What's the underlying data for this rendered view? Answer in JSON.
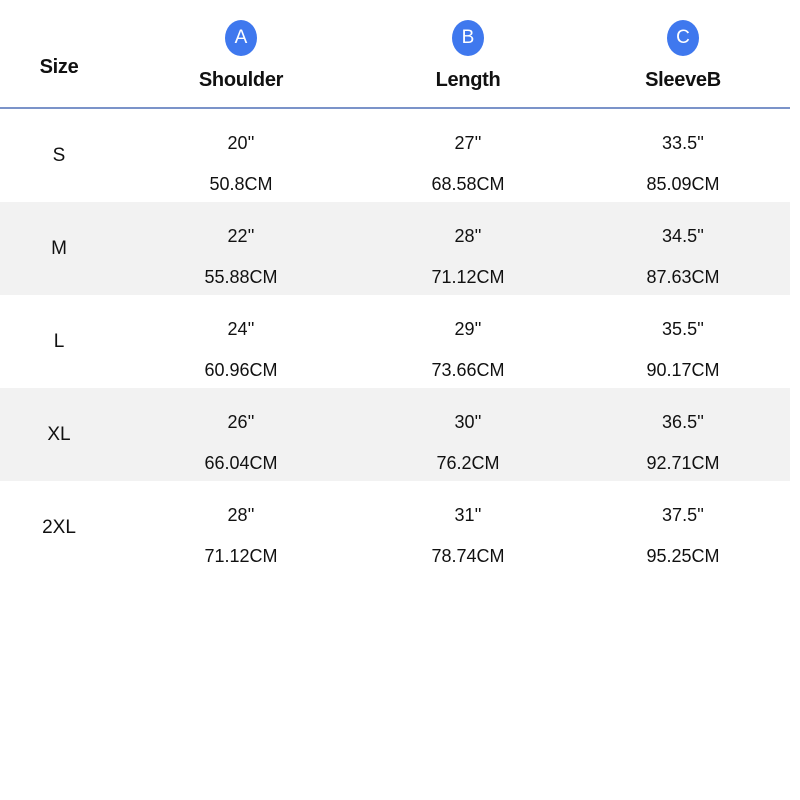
{
  "header": {
    "size_label": "Size",
    "columns": [
      {
        "badge": "A",
        "label": "Shoulder"
      },
      {
        "badge": "B",
        "label": "Length"
      },
      {
        "badge": "C",
        "label": "SleeveB"
      }
    ]
  },
  "colors": {
    "badge": "#3f78ee",
    "divider": "#7b93c9",
    "row_shade": "#f2f2f2"
  },
  "rows": [
    {
      "size": "S",
      "shoulder": {
        "in": "20''",
        "cm": "50.8CM"
      },
      "length": {
        "in": "27''",
        "cm": "68.58CM"
      },
      "sleeve": {
        "in": "33.5''",
        "cm": "85.09CM"
      }
    },
    {
      "size": "M",
      "shoulder": {
        "in": "22''",
        "cm": "55.88CM"
      },
      "length": {
        "in": "28''",
        "cm": "71.12CM"
      },
      "sleeve": {
        "in": "34.5''",
        "cm": "87.63CM"
      }
    },
    {
      "size": "L",
      "shoulder": {
        "in": "24''",
        "cm": "60.96CM"
      },
      "length": {
        "in": "29''",
        "cm": "73.66CM"
      },
      "sleeve": {
        "in": "35.5''",
        "cm": "90.17CM"
      }
    },
    {
      "size": "XL",
      "shoulder": {
        "in": "26''",
        "cm": "66.04CM"
      },
      "length": {
        "in": "30''",
        "cm": "76.2CM"
      },
      "sleeve": {
        "in": "36.5''",
        "cm": "92.71CM"
      }
    },
    {
      "size": "2XL",
      "shoulder": {
        "in": "28''",
        "cm": "71.12CM"
      },
      "length": {
        "in": "31''",
        "cm": "78.74CM"
      },
      "sleeve": {
        "in": "37.5''",
        "cm": "95.25CM"
      }
    }
  ]
}
